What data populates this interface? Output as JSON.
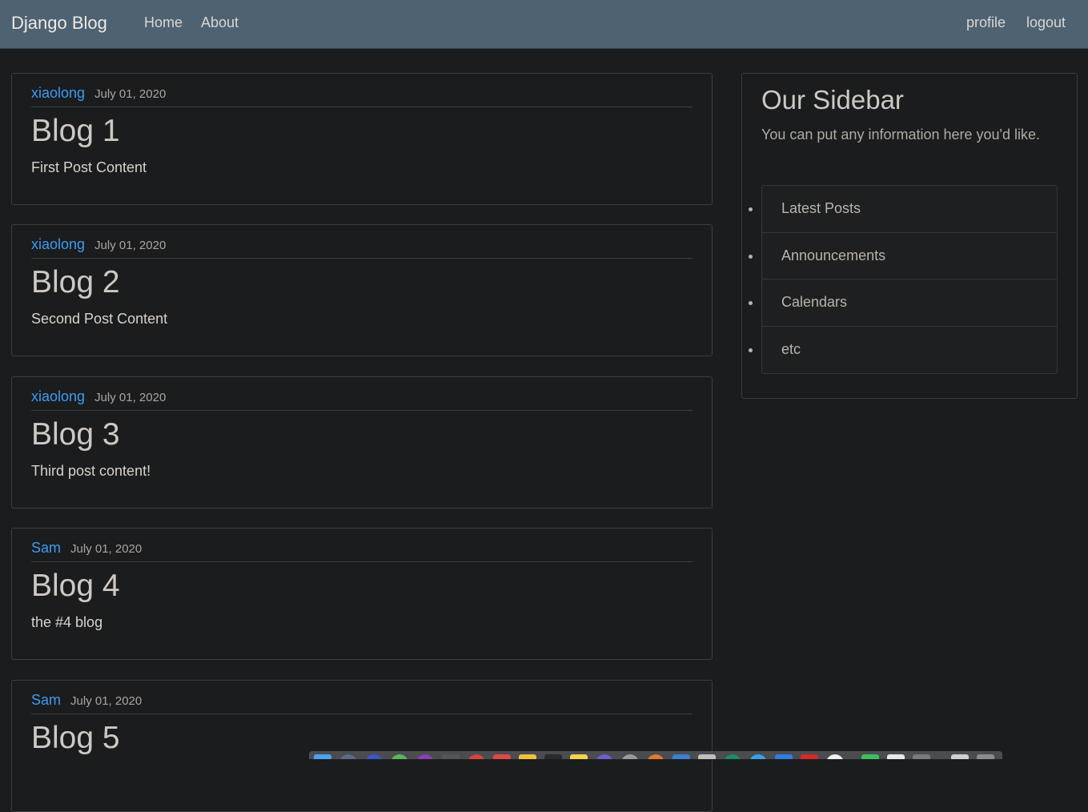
{
  "navbar": {
    "brand": "Django Blog",
    "links": [
      "Home",
      "About"
    ],
    "right_links": [
      "profile",
      "logout"
    ]
  },
  "posts": [
    {
      "author": "xiaolong",
      "date": "July 01, 2020",
      "title": "Blog 1",
      "content": "First Post Content"
    },
    {
      "author": "xiaolong",
      "date": "July 01, 2020",
      "title": "Blog 2",
      "content": "Second Post Content"
    },
    {
      "author": "xiaolong",
      "date": "July 01, 2020",
      "title": "Blog 3",
      "content": "Third post content!"
    },
    {
      "author": "Sam",
      "date": "July 01, 2020",
      "title": "Blog 4",
      "content": "the #4 blog"
    },
    {
      "author": "Sam",
      "date": "July 01, 2020",
      "title": "Blog 5",
      "content": ""
    }
  ],
  "sidebar": {
    "title": "Our Sidebar",
    "text": "You can put any information here you'd like.",
    "items": [
      "Latest Posts",
      "Announcements",
      "Calendars",
      "etc"
    ]
  },
  "colors": {
    "navbar_bg": "#4e6272",
    "page_bg": "#1b1c1e",
    "author_link": "#3b9cf0"
  }
}
